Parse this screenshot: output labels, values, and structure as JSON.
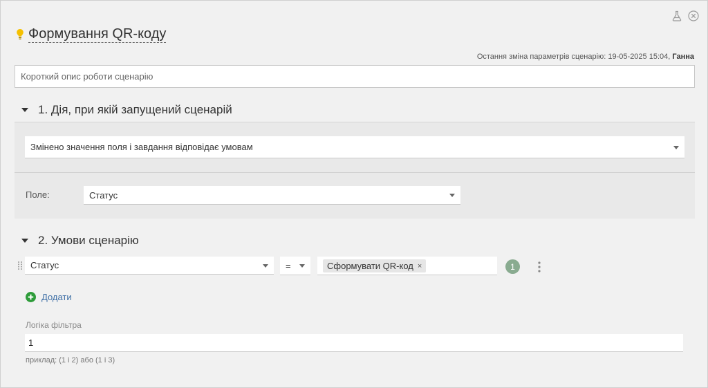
{
  "header": {
    "title": "Формування QR-коду",
    "last_change_label": "Остання зміна параметрів сценарію: 19-05-2025 15:04,",
    "last_change_user": "Ганна"
  },
  "description": {
    "placeholder": "Короткий опис роботи сценарію",
    "value": ""
  },
  "section1": {
    "title": "1. Дія, при якій запущений сценарій",
    "trigger_value": "Змінено значення поля і завдання відповідає умовам",
    "field_label": "Поле:",
    "field_value": "Статус"
  },
  "section2": {
    "title": "2. Умови сценарію",
    "condition": {
      "field": "Статус",
      "operator": "=",
      "tag": "Сформувати QR-код",
      "tag_remove": "×",
      "badge": "1"
    },
    "add_label": "Додати",
    "logic_label": "Логіка фільтра",
    "logic_value": "1",
    "example": "приклад: (1 і 2) або (1 і 3)"
  },
  "icons": {
    "bulb": "lightbulb-icon",
    "flask": "flask-icon",
    "close": "close-circle-icon",
    "drag": "drag-handle-icon",
    "kebab": "kebab-menu-icon",
    "add": "plus-circle-icon"
  },
  "colors": {
    "accent_green": "#2e9c3a",
    "badge": "#89ab90",
    "link": "#3d6ea5",
    "bulb": "#f5c000"
  }
}
